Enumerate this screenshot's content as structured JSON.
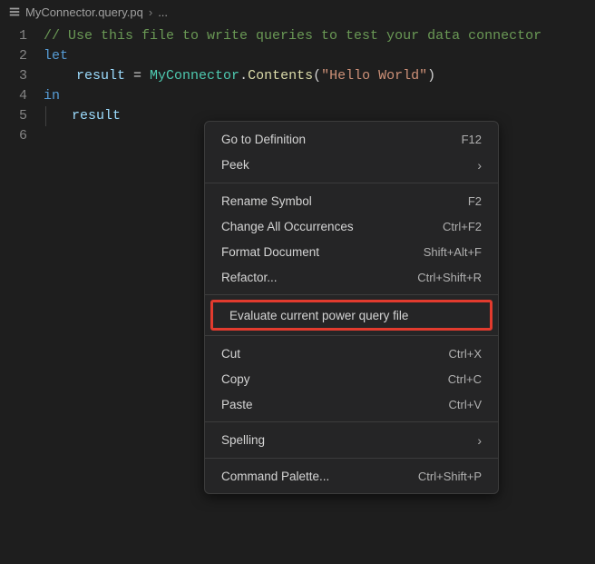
{
  "breadcrumb": {
    "filename": "MyConnector.query.pq",
    "ellipsis": "..."
  },
  "editor": {
    "lines": {
      "l1_comment": "// Use this file to write queries to test your data connector",
      "l2_let": "let",
      "l3_result": "result",
      "l3_eq": " = ",
      "l3_type": "MyConnector",
      "l3_dot": ".",
      "l3_func": "Contents",
      "l3_open": "(",
      "l3_str": "\"Hello World\"",
      "l3_close": ")",
      "l4_in": "in",
      "l5_result": "result"
    },
    "gutter": [
      "1",
      "2",
      "3",
      "4",
      "5",
      "6"
    ]
  },
  "menu": {
    "goto_def": {
      "label": "Go to Definition",
      "shortcut": "F12"
    },
    "peek": {
      "label": "Peek"
    },
    "rename": {
      "label": "Rename Symbol",
      "shortcut": "F2"
    },
    "change_all": {
      "label": "Change All Occurrences",
      "shortcut": "Ctrl+F2"
    },
    "format": {
      "label": "Format Document",
      "shortcut": "Shift+Alt+F"
    },
    "refactor": {
      "label": "Refactor...",
      "shortcut": "Ctrl+Shift+R"
    },
    "evaluate": {
      "label": "Evaluate current power query file"
    },
    "cut": {
      "label": "Cut",
      "shortcut": "Ctrl+X"
    },
    "copy": {
      "label": "Copy",
      "shortcut": "Ctrl+C"
    },
    "paste": {
      "label": "Paste",
      "shortcut": "Ctrl+V"
    },
    "spelling": {
      "label": "Spelling"
    },
    "cmd_palette": {
      "label": "Command Palette...",
      "shortcut": "Ctrl+Shift+P"
    }
  }
}
